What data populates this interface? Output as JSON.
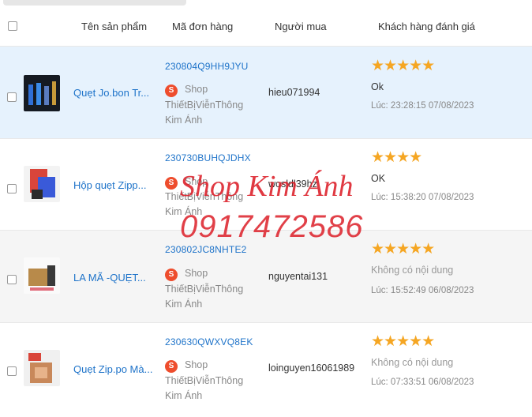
{
  "header": {
    "product_name": "Tên sản phẩm",
    "order_id": "Mã đơn hàng",
    "buyer": "Người mua",
    "rating": "Khách hàng đánh giá"
  },
  "rows": [
    {
      "product_name": "Quẹt Jo.bon Tr...",
      "order_id": "230804Q9HH9JYU",
      "shop_prefix": "Shop",
      "shop_line2": "ThiếtBịViễnThông",
      "shop_line3": "Kim Ánh",
      "buyer": "hieu071994",
      "stars": "★★★★★",
      "star_count": 5,
      "comment": "Ok",
      "time": "Lúc: 23:28:15 07/08/2023",
      "selected": true
    },
    {
      "product_name": "Hộp quẹt Zipp...",
      "order_id": "230730BUHQJDHX",
      "shop_prefix": "Shop",
      "shop_line2": "ThiếtBịViễnThông",
      "shop_line3": "Kim Ánh",
      "buyer": "wosldl39hz",
      "stars": "★★★★",
      "star_count": 4,
      "comment": "OK",
      "time": "Lúc: 15:38:20 07/08/2023",
      "selected": false
    },
    {
      "product_name": "LA MÃ -QUẸT...",
      "order_id": "230802JC8NHTE2",
      "shop_prefix": "Shop",
      "shop_line2": "ThiếtBịViễnThông",
      "shop_line3": "Kim Ánh",
      "buyer": "nguyentai131",
      "stars": "★★★★★",
      "star_count": 5,
      "comment": "Không có nội dung",
      "time": "Lúc: 15:52:49 06/08/2023",
      "selected": false
    },
    {
      "product_name": "Quẹt Zip.po Mà...",
      "order_id": "230630QWXVQ8EK",
      "shop_prefix": "Shop",
      "shop_line2": "ThiếtBịViễnThông",
      "shop_line3": "Kim Ánh",
      "buyer": "loinguyen16061989",
      "stars": "★★★★★",
      "star_count": 5,
      "comment": "Không có nội dung",
      "time": "Lúc: 07:33:51 06/08/2023",
      "selected": false
    }
  ],
  "watermark": {
    "line1": "Shop Kim Ánh",
    "line2": "0917472586"
  },
  "colors": {
    "link": "#1e73c9",
    "star": "#f5a623",
    "selected_row": "#e6f2fd",
    "shop_icon": "#ee4d2d",
    "watermark": "#dc1e28"
  }
}
